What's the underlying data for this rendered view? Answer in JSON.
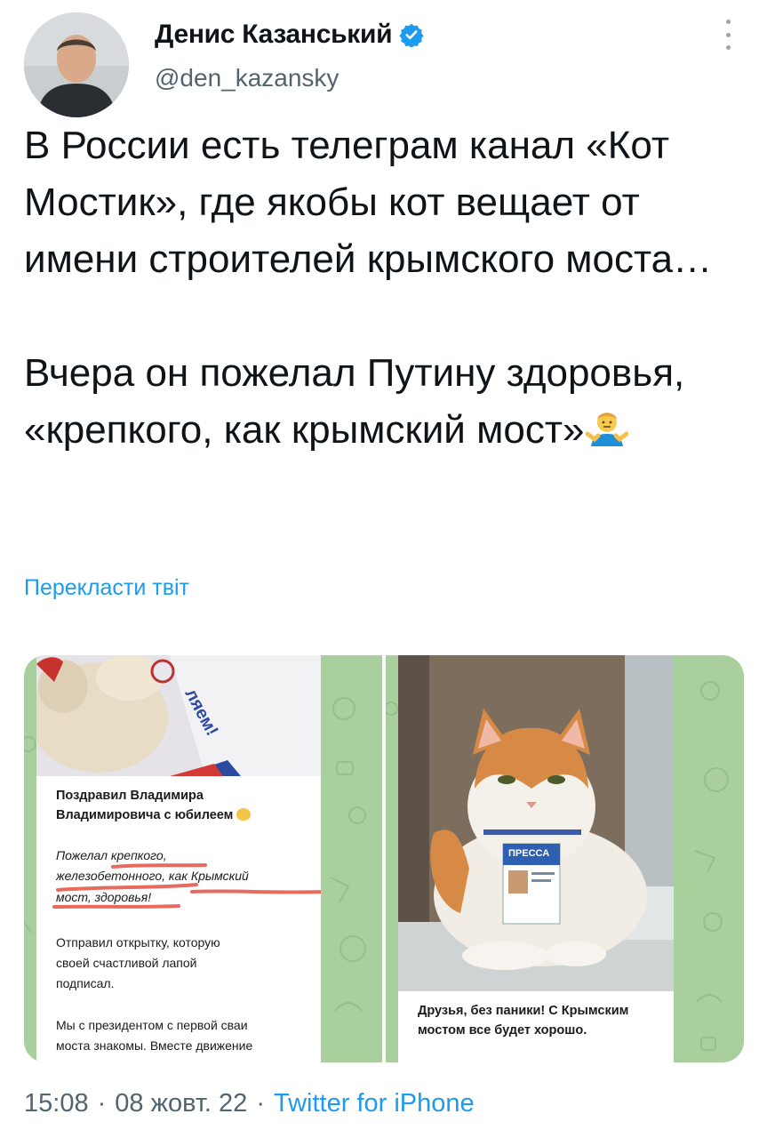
{
  "author": {
    "name": "Денис Казанський",
    "handle": "@den_kazansky"
  },
  "tweet": {
    "text": "В России есть телеграм канал «Кот Мостик», где якобы кот вещает от имени строителей крымского моста…\n\nВчера он пожелал Путину здоровья, «крепкого, как крымский мост»",
    "emoji": "person-shrugging-emoji",
    "translate_label": "Перекласти твіт"
  },
  "media_left": {
    "title_line1": "Поздравил Владимира",
    "title_line2": "Владимировича с юбилеем",
    "quote_line1": "Пожелал крепкого,",
    "quote_line2": "железобетонного, как Крымский",
    "quote_line3": "мост, здоровья!",
    "para1_line1": "Отправил открытку, которую",
    "para1_line2": "своей счастливой лапой",
    "para1_line3": "подписал.",
    "para2_line1": "Мы с президентом с первой сваи",
    "para2_line2": "моста знакомы. Вместе движение",
    "photo_text": "ляем!"
  },
  "media_right": {
    "badge_text": "ПРЕССА",
    "caption_line1": "Друзья, без паники! С Крымским",
    "caption_line2": "мостом все будет хорошо."
  },
  "footer": {
    "time": "15:08",
    "date": "08 жовт. 22",
    "separator": "·",
    "app": "Twitter for iPhone"
  },
  "colors": {
    "accent": "#1d9bf0",
    "muted": "#536471",
    "underline": "#e66a5e",
    "telegram_bg": "#a9cf9d"
  }
}
